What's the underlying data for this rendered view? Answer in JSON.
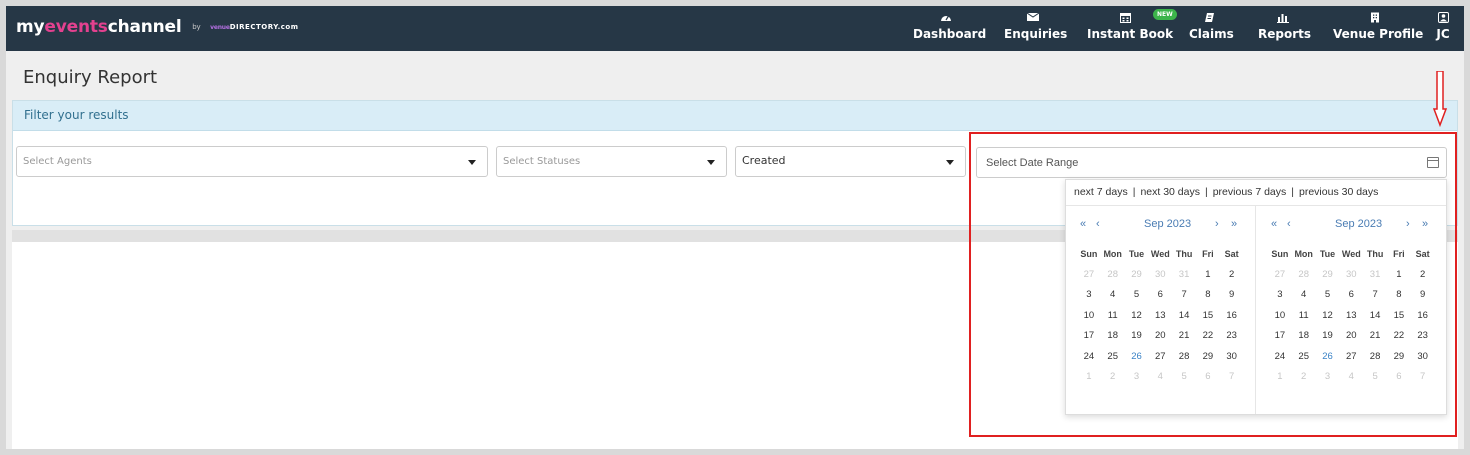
{
  "brand": {
    "part1": "my",
    "part2": "events",
    "part3": "channel",
    "by": "by",
    "partner_top": "venue",
    "partner": "DIRECTORY.com"
  },
  "nav": [
    {
      "label": "Dashboard",
      "icon": "dashboard-icon"
    },
    {
      "label": "Enquiries",
      "icon": "envelope-icon"
    },
    {
      "label": "Instant Book",
      "icon": "calendar-icon",
      "badge": "NEW"
    },
    {
      "label": "Claims",
      "icon": "tag-icon"
    },
    {
      "label": "Reports",
      "icon": "bar-chart-icon"
    },
    {
      "label": "Venue Profile",
      "icon": "building-icon"
    },
    {
      "label": "JC",
      "icon": "user-icon"
    }
  ],
  "page": {
    "title": "Enquiry Report"
  },
  "filters": {
    "heading": "Filter your results",
    "agents_placeholder": "Select Agents",
    "statuses_placeholder": "Select Statuses",
    "date_type_value": "Created",
    "date_range_placeholder": "Select Date Range"
  },
  "datepicker": {
    "ranges": [
      "next 7 days",
      "next 30 days",
      "previous 7 days",
      "previous 30 days"
    ],
    "month_label": "Sep 2023",
    "weekdays": [
      "Sun",
      "Mon",
      "Tue",
      "Wed",
      "Thu",
      "Fri",
      "Sat"
    ],
    "today": "26",
    "weeks": [
      [
        "27",
        "28",
        "29",
        "30",
        "31",
        "1",
        "2"
      ],
      [
        "3",
        "4",
        "5",
        "6",
        "7",
        "8",
        "9"
      ],
      [
        "10",
        "11",
        "12",
        "13",
        "14",
        "15",
        "16"
      ],
      [
        "17",
        "18",
        "19",
        "20",
        "21",
        "22",
        "23"
      ],
      [
        "24",
        "25",
        "26",
        "27",
        "28",
        "29",
        "30"
      ],
      [
        "1",
        "2",
        "3",
        "4",
        "5",
        "6",
        "7"
      ]
    ]
  },
  "colors": {
    "topbar": "#263746",
    "accent_pink": "#e3418f",
    "today": "#3b83c6",
    "highlight": "#e02020"
  }
}
